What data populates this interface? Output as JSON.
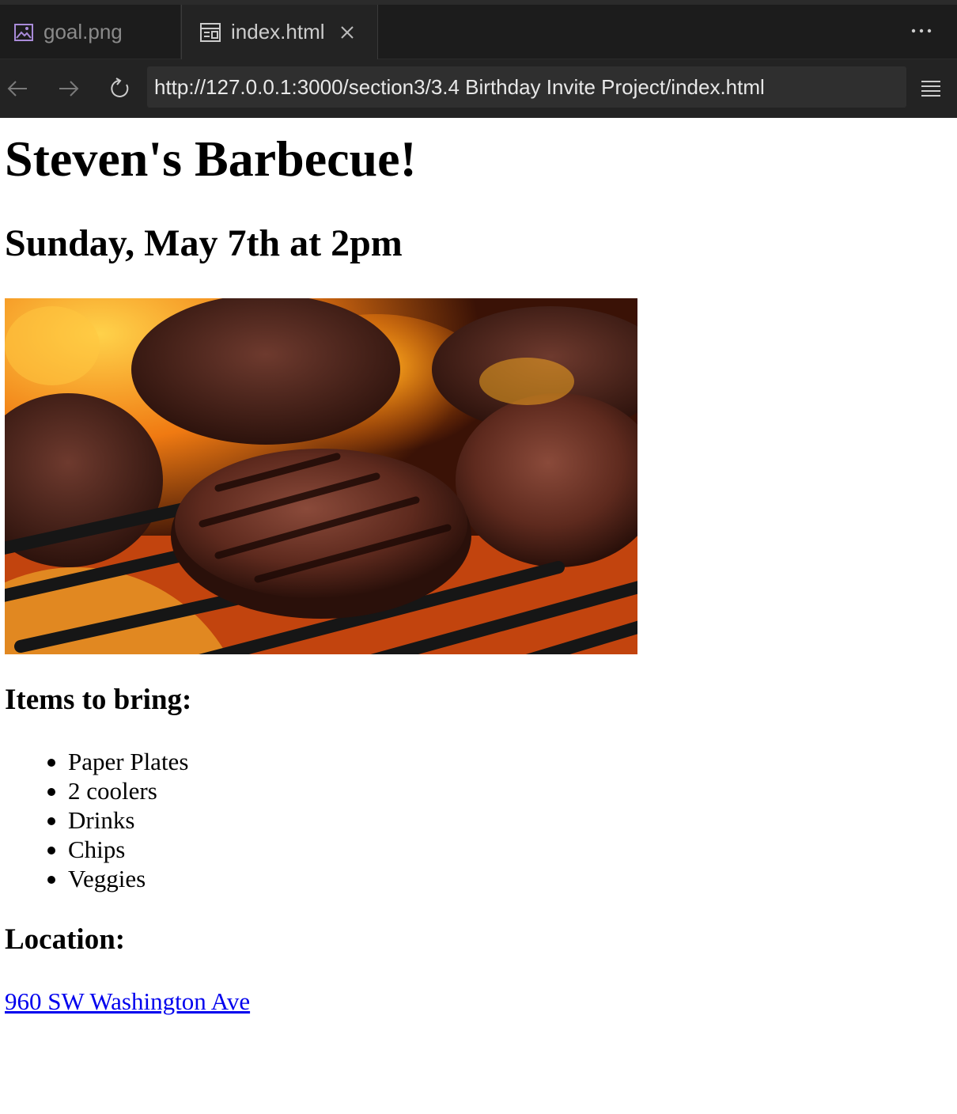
{
  "editor": {
    "tabs": [
      {
        "label": "goal.png",
        "icon": "image-file-icon",
        "active": false
      },
      {
        "label": "index.html",
        "icon": "preview-page-icon",
        "active": true
      }
    ],
    "more_icon": "ellipsis-icon",
    "colors": {
      "chrome_bg": "#1c1c1c",
      "active_tab_bg": "#232323",
      "image_icon": "#a98bd9"
    }
  },
  "browser": {
    "url": "http://127.0.0.1:3000/section3/3.4 Birthday Invite Project/index.html",
    "back_icon": "arrow-left-icon",
    "forward_icon": "arrow-right-icon",
    "reload_icon": "reload-icon",
    "menu_icon": "hamburger-menu-icon"
  },
  "page": {
    "title": "Steven's Barbecue!",
    "date": "Sunday, May 7th at 2pm",
    "image_subject": "burger patties on a flaming grill",
    "items_heading": "Items to bring:",
    "items": [
      "Paper Plates",
      "2 coolers",
      "Drinks",
      "Chips",
      "Veggies"
    ],
    "location_heading": "Location:",
    "location_link": "960 SW Washington Ave",
    "colors": {
      "link": "#0000ee",
      "text": "#000000"
    }
  }
}
